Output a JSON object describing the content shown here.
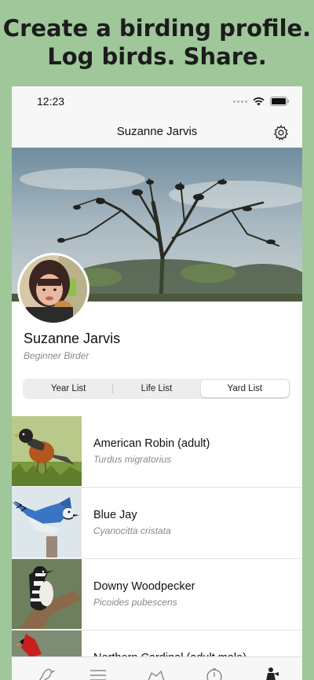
{
  "promo": {
    "line1": "Create a birding profile.",
    "line2": "Log birds. Share."
  },
  "status": {
    "time": "12:23"
  },
  "navbar": {
    "title": "Suzanne Jarvis",
    "settings_icon": "gear-icon"
  },
  "profile": {
    "name": "Suzanne Jarvis",
    "subtitle": "Beginner Birder"
  },
  "tabs": [
    {
      "label": "Year List",
      "selected": false
    },
    {
      "label": "Life List",
      "selected": false
    },
    {
      "label": "Yard List",
      "selected": true
    }
  ],
  "birds": [
    {
      "common": "American Robin (adult)",
      "scientific": "Turdus migratorius"
    },
    {
      "common": "Blue Jay",
      "scientific": "Cyanocitta cristata"
    },
    {
      "common": "Downy Woodpecker",
      "scientific": "Picoides pubescens"
    },
    {
      "common": "Northern Cardinal (adult male)",
      "scientific": ""
    }
  ],
  "bottom_tabs": [
    "bird-icon",
    "list-icon",
    "map-icon",
    "clock-icon",
    "birder-icon"
  ],
  "colors": {
    "background": "#9fc79a",
    "selected_tab": "#ffffff"
  }
}
